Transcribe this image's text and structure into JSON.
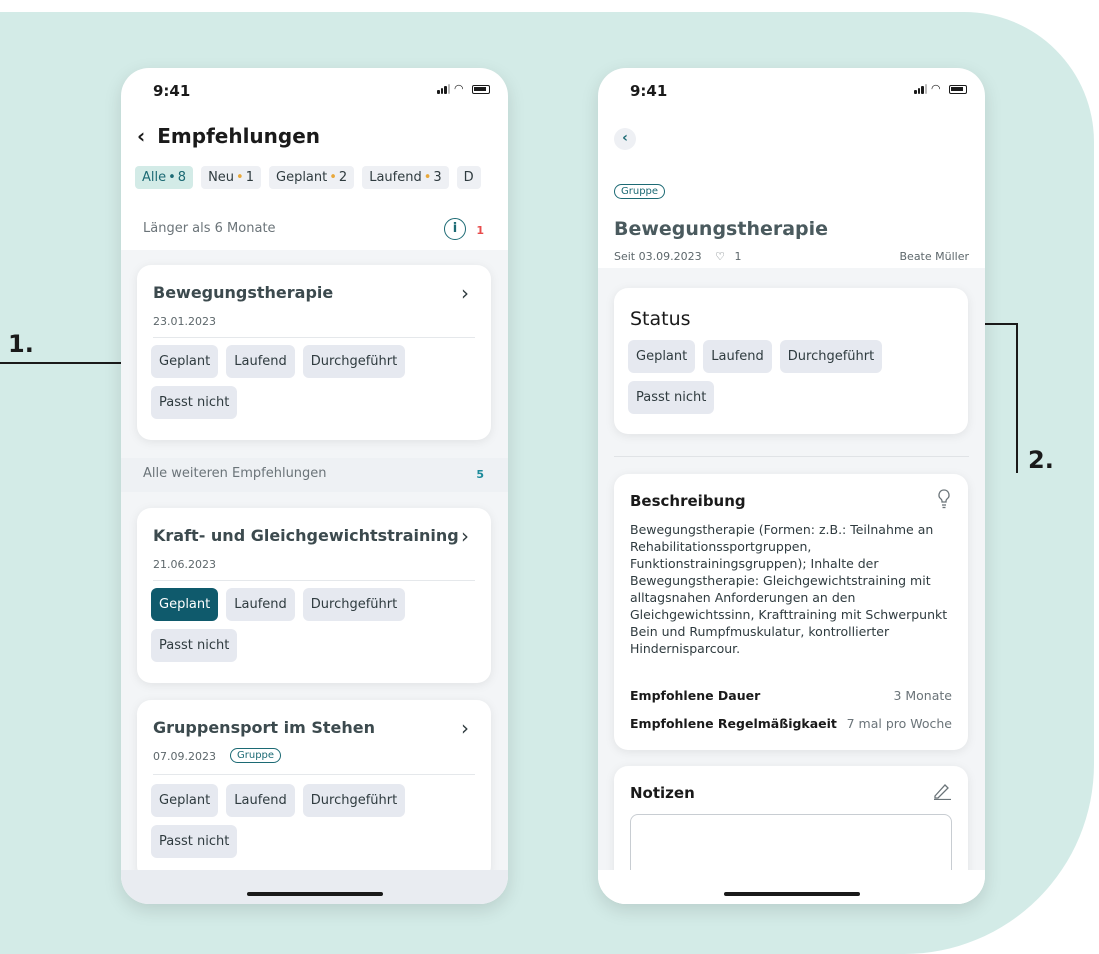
{
  "status_bar": {
    "time": "9:41"
  },
  "left_screen": {
    "title": "Empfehlungen",
    "filters": [
      {
        "label": "Alle",
        "count": "8"
      },
      {
        "label": "Neu",
        "count": "1"
      },
      {
        "label": "Geplant",
        "count": "2"
      },
      {
        "label": "Laufend",
        "count": "3"
      },
      {
        "label": "D",
        "count": ""
      }
    ],
    "section1": {
      "label": "Länger als 6 Monate",
      "count": "1"
    },
    "section2": {
      "label": "Alle weiteren Empfehlungen",
      "count": "5"
    },
    "cards": [
      {
        "title": "Bewegungstherapie",
        "date": "23.01.2023",
        "badge": "",
        "tags": [
          "Geplant",
          "Laufend",
          "Durchgeführt",
          "Passt nicht"
        ],
        "selected": ""
      },
      {
        "title": "Kraft- und Gleichgewichtstraining",
        "date": "21.06.2023",
        "badge": "",
        "tags": [
          "Geplant",
          "Laufend",
          "Durchgeführt",
          "Passt nicht"
        ],
        "selected": "Geplant"
      },
      {
        "title": "Gruppensport im Stehen",
        "date": "07.09.2023",
        "badge": "Gruppe",
        "tags": [
          "Geplant",
          "Laufend",
          "Durchgeführt",
          "Passt nicht"
        ],
        "selected": ""
      }
    ]
  },
  "right_screen": {
    "badge": "Gruppe",
    "title": "Bewegungstherapie",
    "since": "Seit 03.09.2023",
    "likes": "1",
    "author": "Beate Müller",
    "status": {
      "heading": "Status",
      "tags": [
        "Geplant",
        "Laufend",
        "Durchgeführt",
        "Passt nicht"
      ]
    },
    "description": {
      "heading": "Beschreibung",
      "text": "Bewegungstherapie (Formen: z.B.: Teilnahme an Rehabilitationssportgruppen, Funktionstrainingsgruppen); Inhalte der Bewegungstherapie: Gleichgewichtstraining mit alltagsnahen Anforderungen an den Gleichgewichtssinn, Krafttraining mit Schwerpunkt Bein und Rumpfmuskulatur, kontrollierter Hindernisparcour.",
      "duration_label": "Empfohlene Dauer",
      "duration_value": "3 Monate",
      "frequency_label": "Empfohlene Regelmäßigkaeit",
      "frequency_value": "7 mal pro Woche"
    },
    "notes": {
      "heading": "Notizen"
    }
  },
  "callouts": {
    "one": "1.",
    "two": "2."
  },
  "colors": {
    "accent": "#0f5a6c",
    "background": "#d3ebe7",
    "warning": "#e8a83b",
    "alert": "#e84c4c"
  }
}
